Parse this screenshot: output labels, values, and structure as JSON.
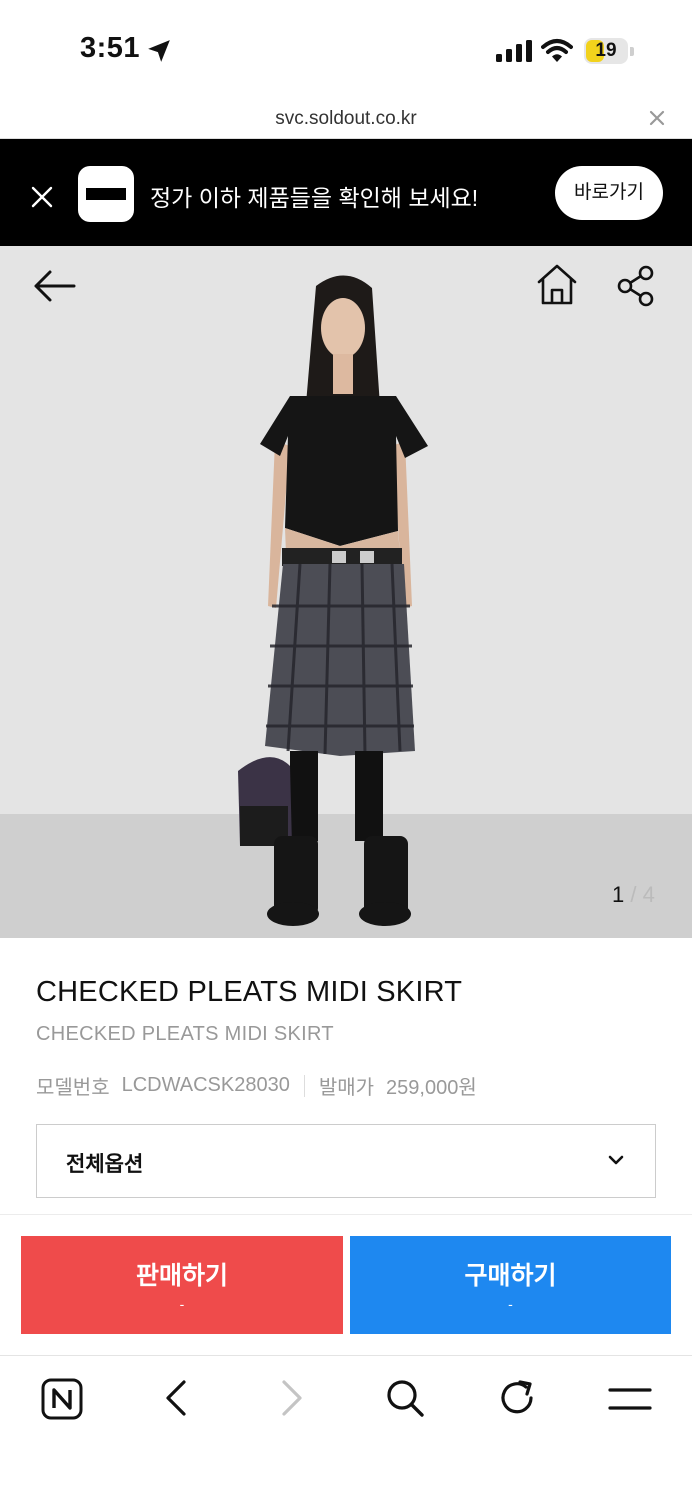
{
  "status_bar": {
    "time": "3:51",
    "battery": "19",
    "icons": [
      "location-arrow-icon",
      "signal-icon",
      "wifi-icon",
      "battery-icon"
    ]
  },
  "browser": {
    "url": "svc.soldout.co.kr"
  },
  "banner": {
    "message": "정가 이하 제품들을 확인해 보세요!",
    "button_label": "바로가기"
  },
  "gallery": {
    "current": "1",
    "separator": "/",
    "total": "4"
  },
  "product": {
    "title": "CHECKED PLEATS MIDI SKIRT",
    "subtitle": "CHECKED PLEATS MIDI SKIRT",
    "model_label": "모델번호",
    "model_number": "LCDWACSK28030",
    "release_price_label": "발매가",
    "release_price": "259,000원"
  },
  "option_select": {
    "selected": "전체옵션"
  },
  "actions": {
    "sell_label": "판매하기",
    "sell_price": "-",
    "buy_label": "구매하기",
    "buy_price": "-"
  },
  "colors": {
    "sell": "#ef4b4b",
    "buy": "#1e88f0",
    "banner_bg": "#000000"
  }
}
